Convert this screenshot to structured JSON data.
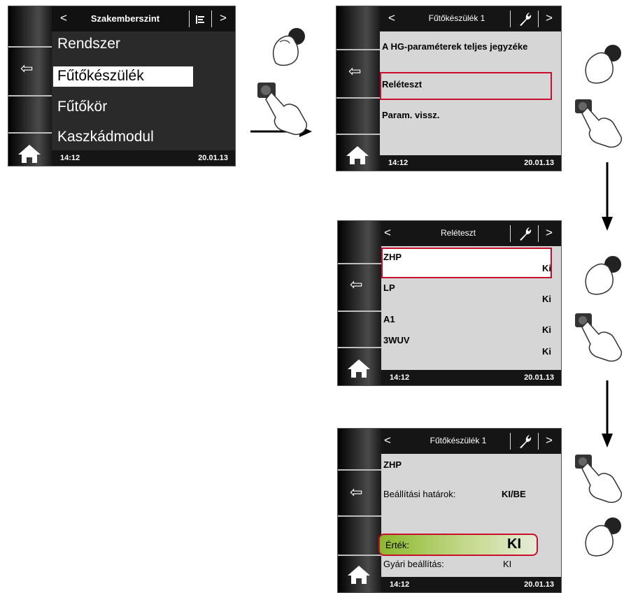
{
  "screen1": {
    "title": "Szakemberszint",
    "menu": [
      "Rendszer",
      "Fűtőkészülék",
      "Fűtőkör",
      "Kaszkádmodul"
    ],
    "selected_index": 1,
    "time": "14:12",
    "date": "20.01.13"
  },
  "screen2": {
    "title": "Fűtőkészülék 1",
    "items": [
      "A HG-paraméterek teljes jegyzéke",
      "Reléteszt",
      "Param. vissz."
    ],
    "selected_index": 1,
    "time": "14:12",
    "date": "20.01.13"
  },
  "screen3": {
    "title": "Reléteszt",
    "rows": [
      {
        "name": "ZHP",
        "value": "Ki"
      },
      {
        "name": "LP",
        "value": "Ki"
      },
      {
        "name": "A1",
        "value": "Ki"
      },
      {
        "name": "3WUV",
        "value": "Ki"
      }
    ],
    "selected_index": 0,
    "time": "14:12",
    "date": "20.01.13"
  },
  "screen4": {
    "title": "Fűtőkészülék 1",
    "heading": "ZHP",
    "limits_label": "Beállítási határok:",
    "limits_value": "KI/BE",
    "value_label": "Érték:",
    "value": "KI",
    "factory_label": "Gyári beállítás:",
    "factory_value": "KI",
    "time": "14:12",
    "date": "20.01.13"
  },
  "colors": {
    "highlight_border": "#c8102e",
    "panel_bg": "#d6d6d6",
    "value_gradient_start": "#8cb82e"
  }
}
